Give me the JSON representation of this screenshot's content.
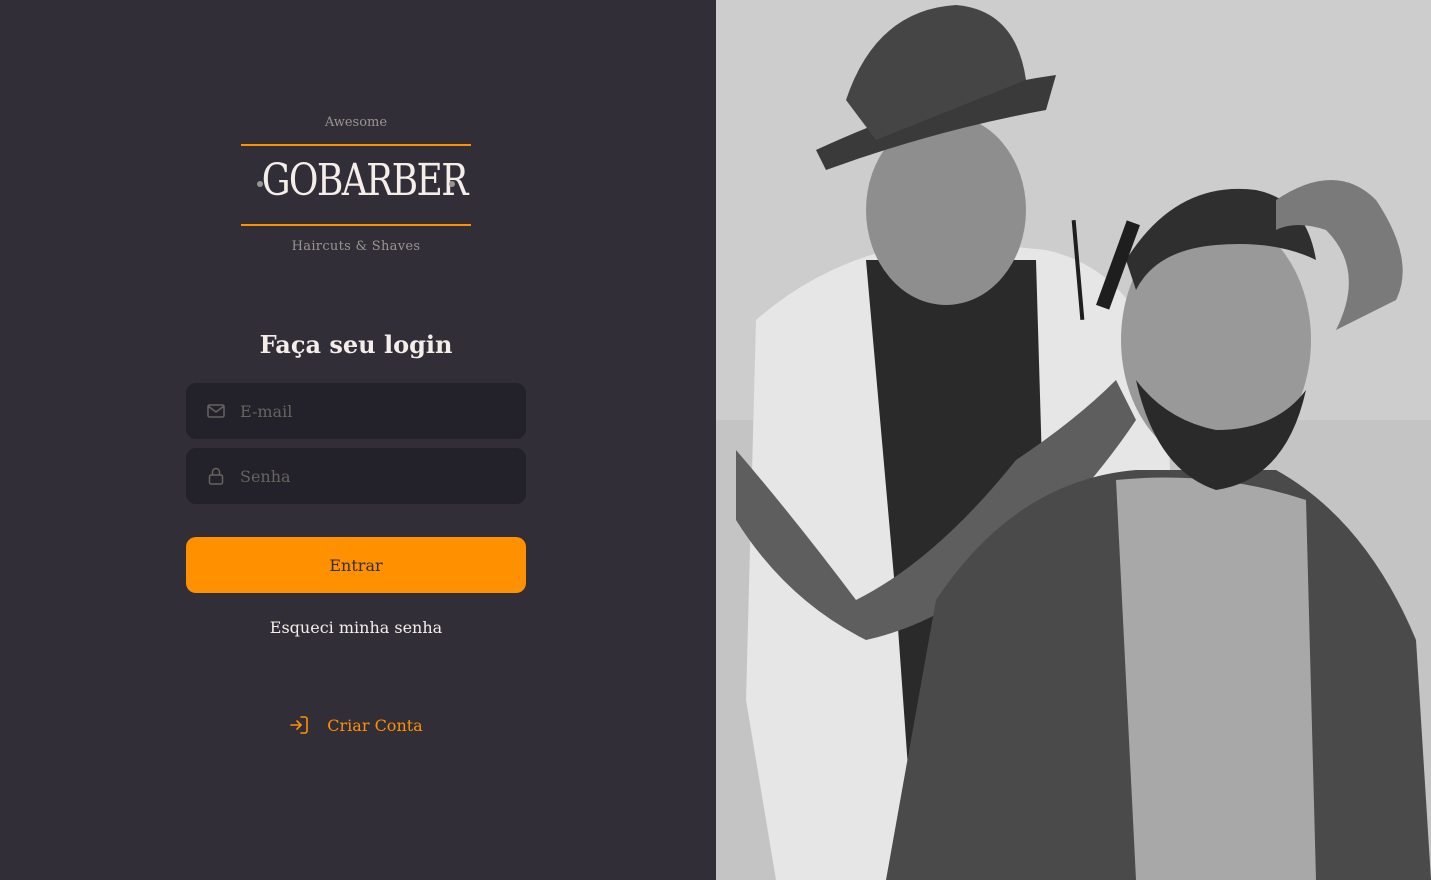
{
  "logo": {
    "top_text": "Awesome",
    "brand": "GOBARBER",
    "bottom_text": "Haircuts & Shaves"
  },
  "form": {
    "title": "Faça seu login",
    "email_placeholder": "E-mail",
    "password_placeholder": "Senha",
    "submit_label": "Entrar",
    "forgot_label": "Esqueci minha senha"
  },
  "create_account": {
    "label": "Criar Conta"
  },
  "icons": {
    "email": "mail-icon",
    "password": "lock-icon",
    "create": "log-in-icon"
  },
  "colors": {
    "background": "#312e38",
    "input_bg": "#232129",
    "accent": "#ff9000",
    "text": "#f4ede8",
    "muted": "#666360"
  }
}
